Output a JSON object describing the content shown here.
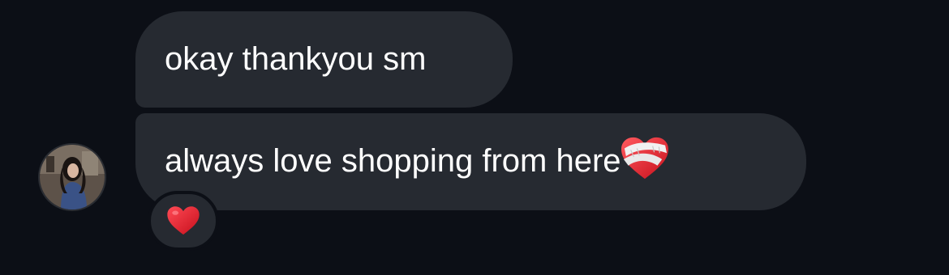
{
  "messages": [
    {
      "text": "okay thankyou sm"
    },
    {
      "text": "always love shopping from here",
      "emoji": "mending-heart"
    }
  ],
  "reaction": {
    "emoji": "red-heart"
  },
  "colors": {
    "background": "#0c0f16",
    "bubble": "#262a31",
    "text": "#ffffff",
    "heart": "#e0232e"
  }
}
